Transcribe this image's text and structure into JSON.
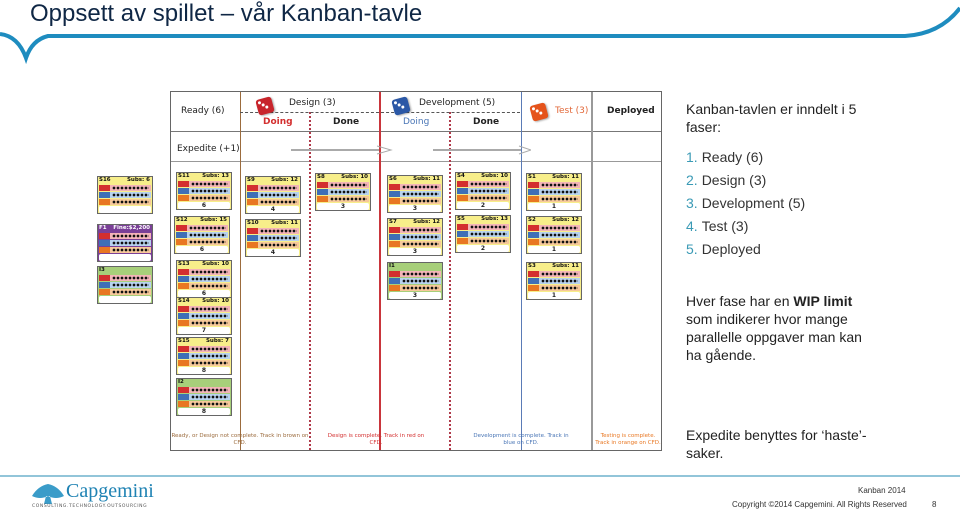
{
  "slide": {
    "title": "Oppsett av spillet – vår Kanban-tavle",
    "accent_color": "#1e8cbf"
  },
  "board": {
    "columns": {
      "ready": "Ready (6)",
      "design": "Design (3)",
      "design_doing": "Doing",
      "design_done": "Done",
      "development": "Development (5)",
      "dev_doing": "Doing",
      "dev_done": "Done",
      "test": "Test (3)",
      "deployed": "Deployed"
    },
    "expedite_label": "Expedite (+1)",
    "colors": {
      "design": "#d32f2f",
      "development": "#3f6fb6",
      "test": "#e87722",
      "ready": "#9b6b3d"
    },
    "footnotes": {
      "ready": "Ready, or Design not complete. Track in brown on CFD.",
      "design": "Design is complete. Track in red on CFD.",
      "development": "Development is complete. Track in blue on CFD.",
      "test": "Testing is complete. Track in orange on CFD."
    },
    "cards": [
      {
        "id": "S16",
        "subs": "Subs: 6",
        "days": "",
        "color": "yellow"
      },
      {
        "id": "F1",
        "subs": "Fine:$2,200",
        "days": "",
        "color": "purple"
      },
      {
        "id": "I3",
        "subs": "",
        "days": "",
        "color": "green"
      },
      {
        "id": "S11",
        "subs": "Subs: 13",
        "days": "6",
        "color": "yellow"
      },
      {
        "id": "S12",
        "subs": "Subs: 15",
        "days": "6",
        "color": "yellow"
      },
      {
        "id": "S13",
        "subs": "Subs: 10",
        "days": "6",
        "color": "yellow"
      },
      {
        "id": "S14",
        "subs": "Subs: 10",
        "days": "7",
        "color": "yellow"
      },
      {
        "id": "S15",
        "subs": "Subs: 7",
        "days": "8",
        "color": "yellow"
      },
      {
        "id": "I2",
        "subs": "",
        "days": "8",
        "color": "green"
      },
      {
        "id": "S9",
        "subs": "Subs: 12",
        "days": "4",
        "color": "yellow"
      },
      {
        "id": "S10",
        "subs": "Subs: 11",
        "days": "4",
        "color": "yellow"
      },
      {
        "id": "S8",
        "subs": "Subs: 10",
        "days": "3",
        "color": "yellow"
      },
      {
        "id": "S6",
        "subs": "Subs: 11",
        "days": "3",
        "color": "yellow"
      },
      {
        "id": "S7",
        "subs": "Subs: 12",
        "days": "3",
        "color": "yellow"
      },
      {
        "id": "I1",
        "subs": "",
        "days": "3",
        "color": "green"
      },
      {
        "id": "S4",
        "subs": "Subs: 10",
        "days": "2",
        "color": "yellow"
      },
      {
        "id": "S5",
        "subs": "Subs: 13",
        "days": "2",
        "color": "yellow"
      },
      {
        "id": "S1",
        "subs": "Subs: 11",
        "days": "1",
        "color": "yellow"
      },
      {
        "id": "S2",
        "subs": "Subs: 12",
        "days": "1",
        "color": "yellow"
      },
      {
        "id": "S3",
        "subs": "Subs: 11",
        "days": "1",
        "color": "yellow"
      }
    ]
  },
  "sidebar": {
    "intro": "Kanban-tavlen er inndelt i 5 faser:",
    "phases": [
      {
        "num": "1.",
        "label": "Ready (6)"
      },
      {
        "num": "2.",
        "label": "Design (3)"
      },
      {
        "num": "3.",
        "label": "Development (5)"
      },
      {
        "num": "4.",
        "label": "Test (3)"
      },
      {
        "num": "5.",
        "label": "Deployed"
      }
    ],
    "wip_prefix": "Hver fase har en ",
    "wip_bold": "WIP limit",
    "wip_suffix": " som indikerer hvor mange parallelle oppgaver man kan ha gående.",
    "expedite_note": "Expedite benyttes for ‘haste’-saker."
  },
  "footer": {
    "logo_text": "Capgemini",
    "logo_tagline": "CONSULTING.TECHNOLOGY.OUTSOURCING",
    "subject": "Kanban 2014",
    "copyright": "Copyright ©2014 Capgemini. All Rights Reserved",
    "page_number": "8"
  }
}
